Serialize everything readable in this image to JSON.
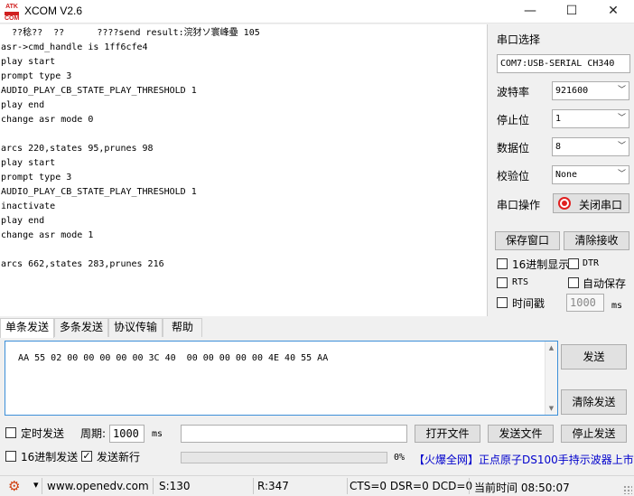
{
  "window": {
    "logo_top": "ATK",
    "logo_bottom": "COM",
    "title": "XCOM V2.6",
    "min_glyph": "—",
    "max_glyph": "☐",
    "close_glyph": "✕"
  },
  "output": {
    "lines": [
      "  ??稔??  ??      ????send result:浣犲ソ寰峰疉 105",
      "asr->cmd_handle is 1ff6cfe4",
      "play start",
      "prompt type 3",
      "AUDIO_PLAY_CB_STATE_PLAY_THRESHOLD 1",
      "play end",
      "change asr mode 0",
      "",
      "arcs 220,states 95,prunes 98",
      "play start",
      "prompt type 3",
      "AUDIO_PLAY_CB_STATE_PLAY_THRESHOLD 1",
      "inactivate",
      "play end",
      "change asr mode 1",
      "",
      "arcs 662,states 283,prunes 216"
    ]
  },
  "serial": {
    "port_label": "串口选择",
    "port_value": "COM7:USB-SERIAL CH340",
    "baud_label": "波特率",
    "baud_value": "921600",
    "stop_label": "停止位",
    "stop_value": "1",
    "data_label": "数据位",
    "data_value": "8",
    "parity_label": "校验位",
    "parity_value": "None",
    "op_label": "串口操作",
    "op_button": "关闭串口",
    "led_color": "#e02020",
    "save_window": "保存窗口",
    "clear_recv": "清除接收",
    "hex_display": "16进制显示",
    "dtr": "DTR",
    "rts": "RTS",
    "auto_save": "自动保存",
    "timestamp": "时间戳",
    "timestamp_value": "1000",
    "timestamp_unit": "ms"
  },
  "tabs": [
    "单条发送",
    "多条发送",
    "协议传输",
    "帮助"
  ],
  "send": {
    "text": "AA 55 02 00 00 00 00 00 3C 40  00 00 00 00 00 4E 40 55 AA",
    "send_button": "发送",
    "clear_send_button": "清除发送",
    "scroll_up": "▲",
    "scroll_down": "▼",
    "timed_send": "定时发送",
    "period_label": "周期:",
    "period_value": "1000",
    "period_unit": "ms",
    "open_file": "打开文件",
    "send_file": "发送文件",
    "stop_send": "停止发送",
    "hex_send": "16进制发送",
    "send_newline": "发送新行",
    "send_newline_checked": "✓",
    "progress_percent": "0%",
    "progress_value": 0,
    "ad_text": "【火爆全网】正点原子DS100手持示波器上市"
  },
  "status": {
    "gear": "⚙",
    "dropdown": "▾",
    "website": "www.openedv.com",
    "sent": "S:130",
    "received": "R:347",
    "lines": "CTS=0 DSR=0 DCD=0",
    "time": "当前时间 08:50:07"
  }
}
